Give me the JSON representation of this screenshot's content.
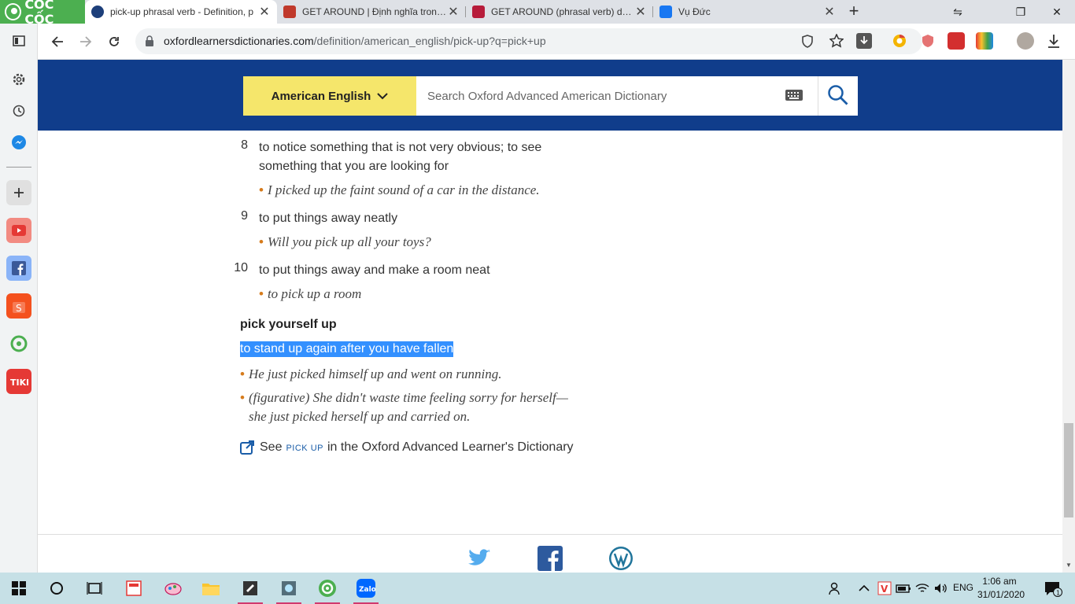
{
  "browser": {
    "brand": "CỐC CỐC",
    "tabs": [
      {
        "title": "pick-up phrasal verb - Definition, p",
        "active": true
      },
      {
        "title": "GET AROUND | Định nghĩa trong T",
        "active": false
      },
      {
        "title": "GET AROUND (phrasal verb) defini",
        "active": false
      },
      {
        "title": "Vụ Đức",
        "active": false
      }
    ],
    "url_domain": "oxfordlearnersdictionaries.com",
    "url_path": "/definition/american_english/pick-up?q=pick+up"
  },
  "header": {
    "language": "American English",
    "search_placeholder": "Search Oxford Advanced American Dictionary"
  },
  "senses": [
    {
      "num": "8",
      "def_lines": [
        "to notice something that is not very obvious; to see",
        "something that you are looking for"
      ],
      "example": "I picked up the faint sound of a car in the distance."
    },
    {
      "num": "9",
      "def_lines": [
        "to put things away neatly"
      ],
      "example": "Will you pick up all your toys?"
    },
    {
      "num": "10",
      "def_lines": [
        "to put things away and make a room neat"
      ],
      "example": "to pick up a room"
    }
  ],
  "idiom": {
    "phrase": "pick yourself up",
    "definition": "to stand up again after you have fallen",
    "examples": [
      {
        "label": "(figurative)",
        "lines": [
          "He just picked himself up and went on running."
        ]
      },
      {
        "lines": [
          "She didn't waste time feeling sorry for herself—",
          "she just picked herself up and carried on."
        ]
      }
    ]
  },
  "see_also": {
    "prefix": "See",
    "link": "pick up",
    "suffix": "in the Oxford Advanced Learner's Dictionary"
  },
  "taskbar": {
    "language": "ENG",
    "time": "1:06 am",
    "date": "31/01/2020",
    "notifications": "1"
  },
  "colors": {
    "banner": "#103d8b",
    "language_selector": "#f5e66b",
    "bullet": "#d67b1c",
    "selection": "#3390ff",
    "link": "#1a5da8"
  }
}
